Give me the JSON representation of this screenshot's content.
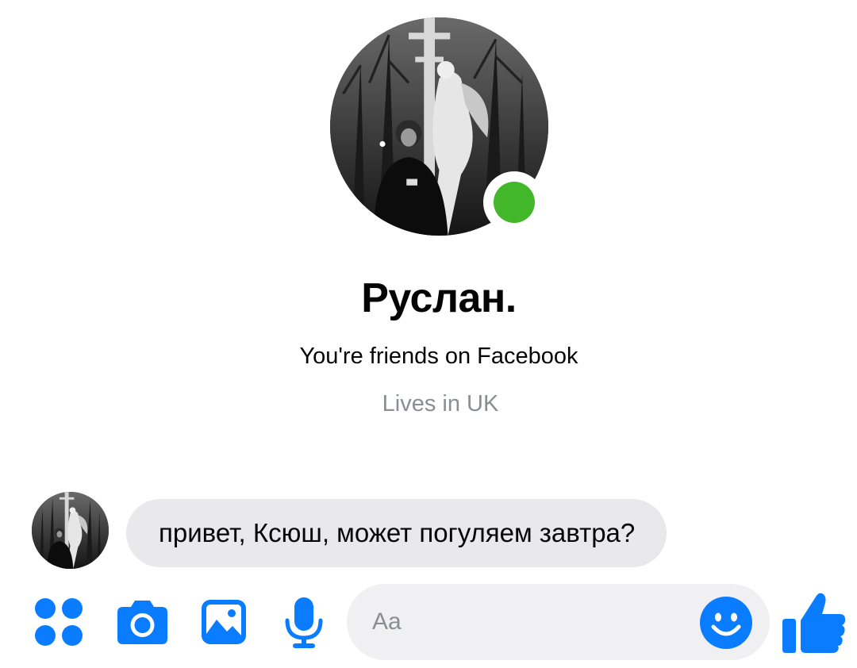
{
  "theme": {
    "accent": "#0a7cff",
    "online": "#42b72a",
    "bubble_bg": "#e9e9eb",
    "input_bg": "#f0f0f2"
  },
  "profile": {
    "name": "Руслан.",
    "friend_status": "You're friends on Facebook",
    "location": "Lives in UK",
    "online": true
  },
  "messages": [
    {
      "sender": "Руслан.",
      "text": "привет, Ксюш, может погуляем завтра?"
    }
  ],
  "composer": {
    "placeholder": "Aa",
    "icons": [
      "apps-icon",
      "camera-icon",
      "gallery-icon",
      "microphone-icon",
      "emoji-icon",
      "thumbs-up-icon"
    ]
  }
}
